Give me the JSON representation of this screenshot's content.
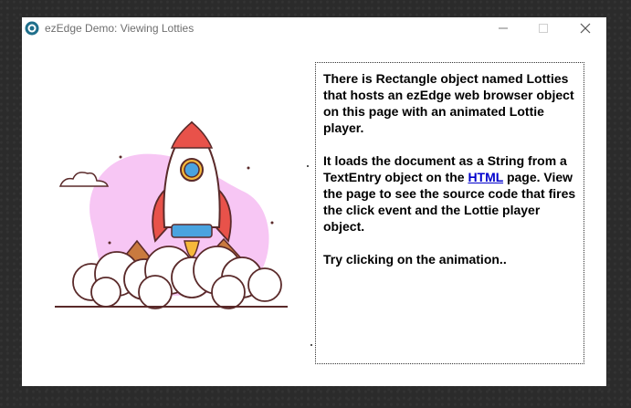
{
  "window": {
    "title": "ezEdge Demo: Viewing Lotties",
    "icon": "ezedge-app-icon",
    "controls": [
      "minimize-icon",
      "maximize-icon",
      "close-icon"
    ]
  },
  "content": {
    "paragraph1": "There is  Rectangle object named Lotties that hosts an ezEdge web browser object on this page with an animated Lottie player.",
    "paragraph2_before": "It loads the document as a String from a TextEntry object  on the ",
    "paragraph2_link": "HTML",
    "paragraph2_after": " page. View the page to see the source code that fires the click event and the Lottie player object.",
    "paragraph3": "Try clicking on the animation.."
  },
  "illustration": {
    "icon": "rocket-launch-animation",
    "colors": {
      "blob": "#f7c6f4",
      "rocket_body": "#ffffff",
      "fins": "#e8524a",
      "window": "#4aa3df",
      "smoke": "#ffffff",
      "outline": "#5a2a2a"
    }
  }
}
